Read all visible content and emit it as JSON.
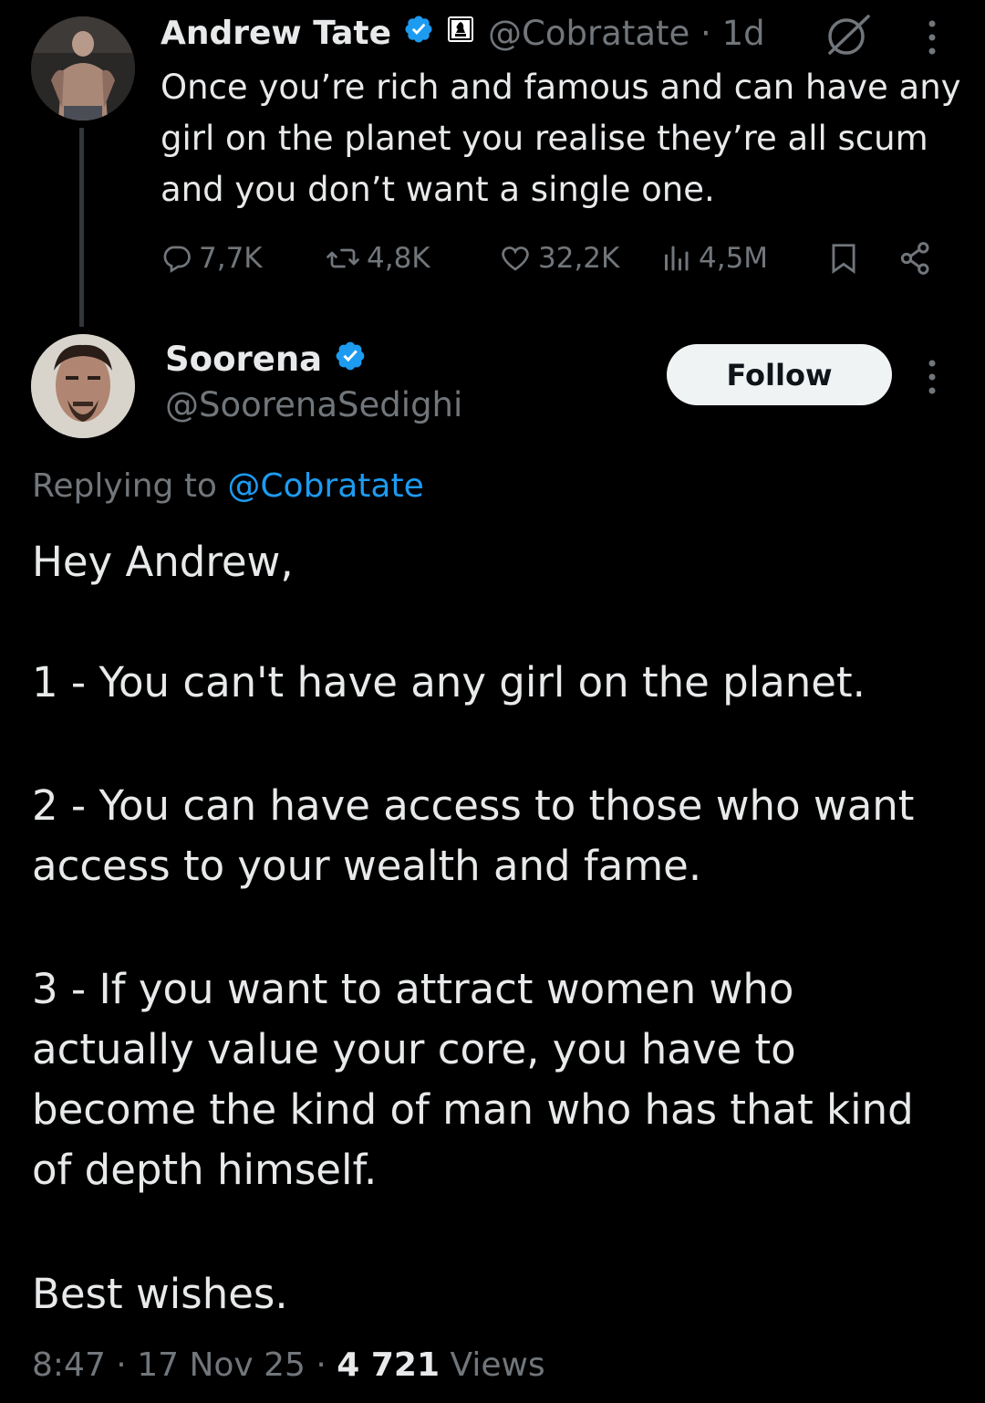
{
  "parent_tweet": {
    "author_name": "Andrew Tate",
    "handle": "@Cobratate",
    "time": "1d",
    "text": "Once you’re rich and famous and can have any girl on the planet you realise they’re all scum and you don’t want a single one.",
    "stats": {
      "replies": "7,7K",
      "reposts": "4,8K",
      "likes": "32,2K",
      "views": "4,5M"
    }
  },
  "reply": {
    "author_name": "Soorena",
    "handle": "@SoorenaSedighi",
    "follow_label": "Follow",
    "replying_prefix": "Replying to",
    "replying_handle": "@Cobratate",
    "paragraphs": [
      "Hey Andrew,",
      "1 - You can't have any girl on the planet.",
      "2 - You can have access to those who want access to your wealth and fame.",
      "3 - If you want to attract women who actually value your core, you have to become the kind of man who has that kind of depth himself.",
      "Best wishes."
    ],
    "footer": {
      "time": "8:47",
      "date": "17 Nov 25",
      "views_count": "4 721",
      "views_label": "Views"
    }
  },
  "colors": {
    "background": "#000000",
    "text": "#e7e9ea",
    "muted": "#71767b",
    "accent": "#1d9bf0",
    "follow_bg": "#eff3f4"
  },
  "icons": [
    "verified-badge-icon",
    "affiliate-badge-icon",
    "grok-icon",
    "more-icon",
    "reply-icon",
    "repost-icon",
    "like-icon",
    "views-icon",
    "bookmark-icon",
    "share-icon"
  ]
}
